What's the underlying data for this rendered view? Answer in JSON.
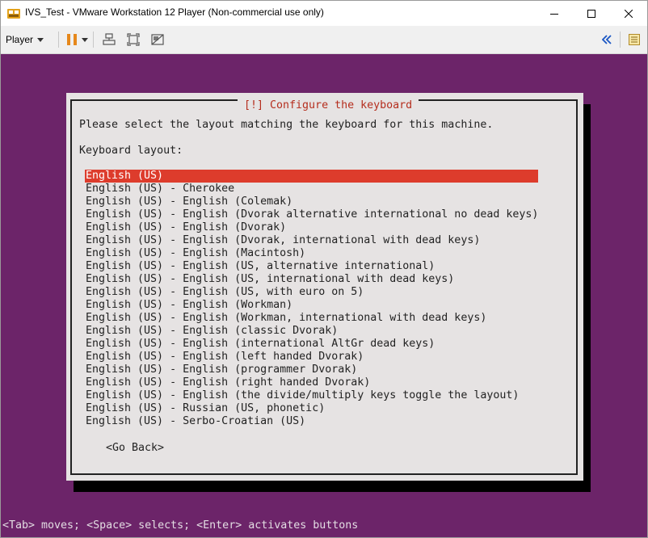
{
  "window": {
    "title": "IVS_Test - VMware Workstation 12 Player (Non-commercial use only)"
  },
  "titlebar_icons": [
    "app-icon",
    "minimize-icon",
    "maximize-icon",
    "close-icon"
  ],
  "toolbar": {
    "player_label": "Player",
    "icons": [
      "chevron-down-icon",
      "pause-icon",
      "send-ctrl-alt-del-icon",
      "full-screen-icon",
      "unity-icon",
      "back-arrows-icon",
      "library-icon"
    ]
  },
  "installer": {
    "title": "[!] Configure the keyboard",
    "instruction": "Please select the layout matching the keyboard for this machine.",
    "layout_label": "Keyboard layout:",
    "selected_index": 0,
    "layouts": [
      "English (US)",
      "English (US) - Cherokee",
      "English (US) - English (Colemak)",
      "English (US) - English (Dvorak alternative international no dead keys)",
      "English (US) - English (Dvorak)",
      "English (US) - English (Dvorak, international with dead keys)",
      "English (US) - English (Macintosh)",
      "English (US) - English (US, alternative international)",
      "English (US) - English (US, international with dead keys)",
      "English (US) - English (US, with euro on 5)",
      "English (US) - English (Workman)",
      "English (US) - English (Workman, international with dead keys)",
      "English (US) - English (classic Dvorak)",
      "English (US) - English (international AltGr dead keys)",
      "English (US) - English (left handed Dvorak)",
      "English (US) - English (programmer Dvorak)",
      "English (US) - English (right handed Dvorak)",
      "English (US) - English (the divide/multiply keys toggle the layout)",
      "English (US) - Russian (US, phonetic)",
      "English (US) - Serbo-Croatian (US)"
    ],
    "go_back": "<Go Back>",
    "status_hint": "<Tab> moves; <Space> selects; <Enter> activates buttons"
  },
  "colors": {
    "console_background": "#6c2469",
    "dialog_background": "#e6e3e3",
    "selection": "#dd3c2c",
    "title_text": "#b52e1e"
  }
}
